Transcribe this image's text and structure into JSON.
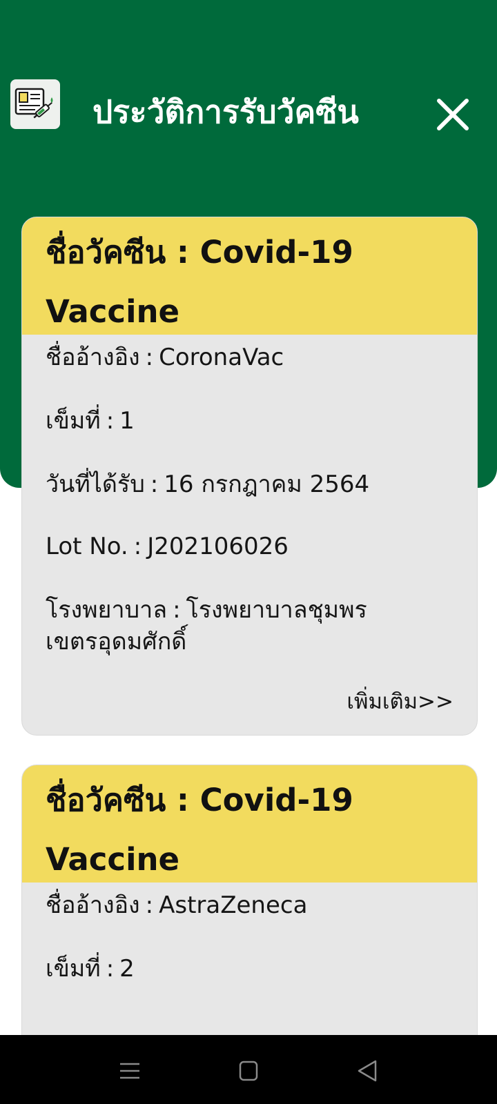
{
  "header": {
    "title": "ประวัติการรับวัคซีน",
    "app_icon": "vaccine-certificate-icon",
    "close_icon": "close-icon",
    "background_color": "#006a3b"
  },
  "cards": [
    {
      "title": "ชื่อวัคซีน : Covid-19 Vaccine",
      "reference_label": "ชื่ออ้างอิง",
      "reference_value": "CoronaVac",
      "dose_label": "เข็มที่",
      "dose_value": "1",
      "date_label": "วันที่ได้รับ",
      "date_value": "16 กรกฎาคม 2564",
      "lot_label": "Lot No.",
      "lot_value": "J202106026",
      "hospital_label": "โรงพยาบาล",
      "hospital_value": "โรงพยาบาลชุมพรเขตรอุดมศักดิ์",
      "more_label": "เพิ่มเติม>>"
    },
    {
      "title": "ชื่อวัคซีน : Covid-19 Vaccine",
      "reference_label": "ชื่ออ้างอิง",
      "reference_value": "AstraZeneca",
      "dose_label": "เข็มที่",
      "dose_value": "2"
    }
  ],
  "colors": {
    "card_header": "#f2db5e",
    "card_body": "#e7e7e7"
  },
  "navbar": {
    "menu_icon": "menu-icon",
    "home_icon": "home-square-icon",
    "back_icon": "back-triangle-icon"
  }
}
